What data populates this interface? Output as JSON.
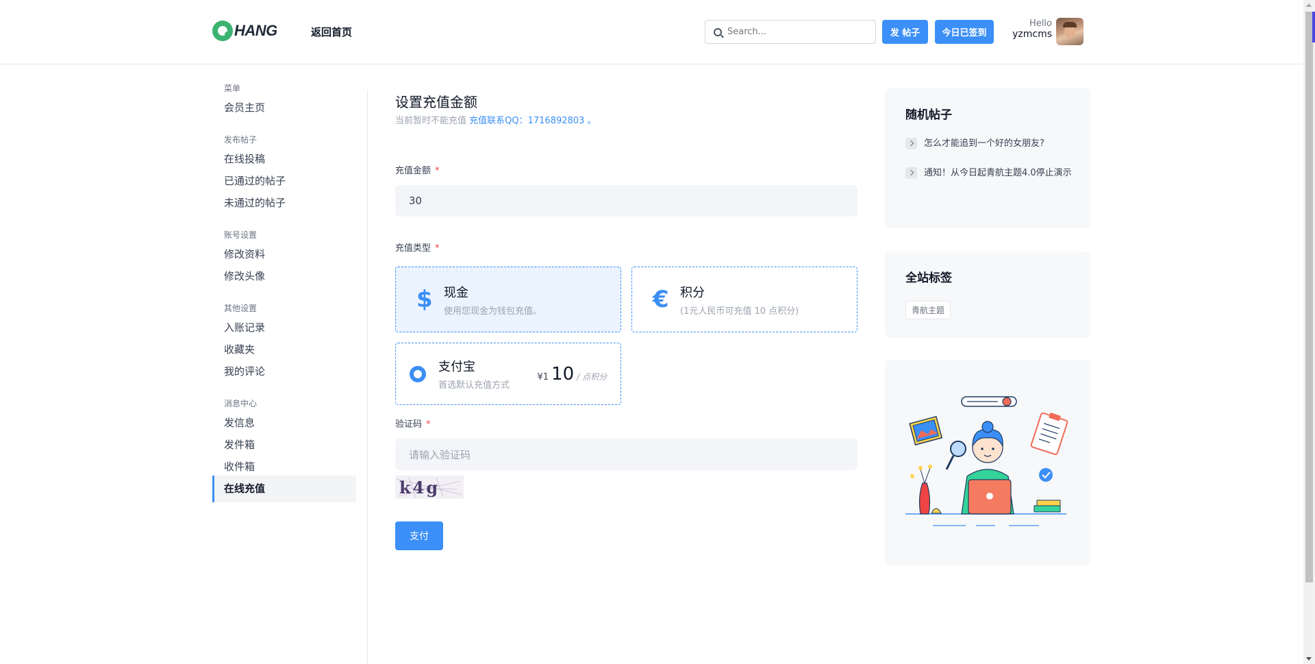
{
  "header": {
    "logo_text": "HANG",
    "nav_home": "返回首页",
    "search_placeholder": "Search...",
    "post_button": "发 帖子",
    "checkin_button": "今日已签到",
    "greeting": "Hello",
    "username": "yzmcms"
  },
  "sidebar": {
    "sections": [
      {
        "title": "菜单",
        "items": [
          "会员主页"
        ]
      },
      {
        "title": "发布帖子",
        "items": [
          "在线投稿",
          "已通过的帖子",
          "未通过的帖子"
        ]
      },
      {
        "title": "账号设置",
        "items": [
          "修改资料",
          "修改头像"
        ]
      },
      {
        "title": "其他设置",
        "items": [
          "入账记录",
          "收藏夹",
          "我的评论"
        ]
      },
      {
        "title": "消息中心",
        "items": [
          "发信息",
          "发件箱",
          "收件箱",
          "在线充值"
        ]
      }
    ],
    "active_item": "在线充值"
  },
  "main": {
    "title": "设置充值金额",
    "note_text": "当前暂时不能充值",
    "note_link": "充值联系QQ：1716892803 。",
    "amount_label": "充值金额",
    "required_mark": "*",
    "amount_value": "30",
    "type_label": "充值类型",
    "options": [
      {
        "icon": "$",
        "title": "现金",
        "subtitle": "使用您现金为钱包充值。",
        "selected": true
      },
      {
        "icon": "€",
        "title": "积分",
        "subtitle": "(1元人民币可充值 10 点积分)",
        "selected": false
      }
    ],
    "alipay": {
      "title": "支付宝",
      "subtitle": "首选默认充值方式",
      "currency": "¥1",
      "points": "10",
      "unit": "/ 点积分"
    },
    "captcha_label": "验证码",
    "captcha_placeholder": "请输入验证码",
    "captcha_text": "k4g",
    "pay_button": "支付"
  },
  "right": {
    "random_title": "随机帖子",
    "random_posts": [
      "怎么才能追到一个好的女朋友?",
      "通知！从今日起青航主题4.0停止演示"
    ],
    "tags_title": "全站标签",
    "tags": [
      "青航主题"
    ]
  },
  "colors": {
    "accent": "#3b8ff6",
    "required": "#ef4444",
    "card_bg": "#f7f8fa"
  }
}
